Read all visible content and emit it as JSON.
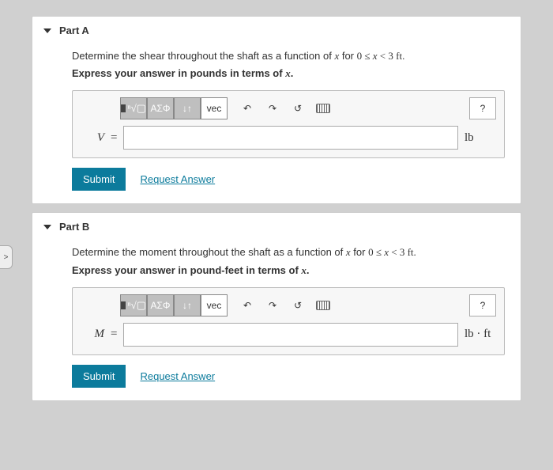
{
  "partA": {
    "title": "Part A",
    "prompt_prefix": "Determine the shear throughout the shaft as a function of ",
    "var": "x",
    "prompt_for": " for ",
    "range_lhs": "0 ≤ ",
    "range_rhs": " < 3 ft.",
    "express_prefix": "Express your answer in pounds in terms of ",
    "express_suffix": ".",
    "answer_var": "V",
    "eq": "=",
    "unit": "lb",
    "submit": "Submit",
    "request": "Request Answer",
    "help": "?"
  },
  "partB": {
    "title": "Part B",
    "prompt_prefix": "Determine the moment throughout the shaft as a function of ",
    "var": "x",
    "prompt_for": " for ",
    "range_lhs": "0 ≤ ",
    "range_rhs": " < 3 ft.",
    "express_prefix": "Express your answer in pound-feet in terms of ",
    "express_suffix": ".",
    "answer_var": "M",
    "eq": "=",
    "unit": "lb · ft",
    "submit": "Submit",
    "request": "Request Answer",
    "help": "?"
  },
  "toolbar": {
    "templates": "templates",
    "root": "ⁿ√▢",
    "greek": "ΑΣΦ",
    "subsup": "↓↑",
    "vec": "vec",
    "undo": "↶",
    "redo": "↷",
    "reset": "↺",
    "keyboard": "keyboard"
  }
}
